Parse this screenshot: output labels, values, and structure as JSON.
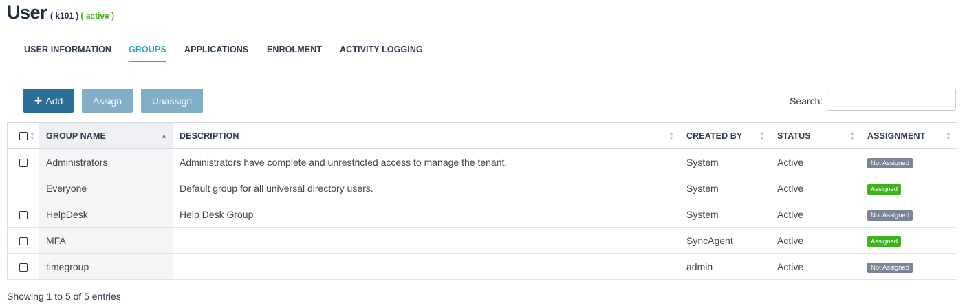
{
  "header": {
    "title": "User",
    "user_id": "( k101 )",
    "status": "( active )"
  },
  "tabs": [
    {
      "label": "USER INFORMATION",
      "active": false
    },
    {
      "label": "GROUPS",
      "active": true
    },
    {
      "label": "APPLICATIONS",
      "active": false
    },
    {
      "label": "ENROLMENT",
      "active": false
    },
    {
      "label": "ACTIVITY LOGGING",
      "active": false
    }
  ],
  "toolbar": {
    "add_label": "Add",
    "assign_label": "Assign",
    "unassign_label": "Unassign"
  },
  "search": {
    "label": "Search:",
    "value": "",
    "placeholder": ""
  },
  "table": {
    "columns": [
      "GROUP NAME",
      "DESCRIPTION",
      "CREATED BY",
      "STATUS",
      "ASSIGNMENT"
    ],
    "sort": {
      "column": "GROUP NAME",
      "direction": "ascending"
    },
    "rows": [
      {
        "checkbox": true,
        "name": "Administrators",
        "description": "Administrators have complete and unrestricted access to manage the tenant.",
        "created_by": "System",
        "status": "Active",
        "assignment": "Not Assigned"
      },
      {
        "checkbox": false,
        "name": "Everyone",
        "description": "Default group for all universal directory users.",
        "created_by": "System",
        "status": "Active",
        "assignment": "Assigned"
      },
      {
        "checkbox": true,
        "name": "HelpDesk",
        "description": "Help Desk Group",
        "created_by": "System",
        "status": "Active",
        "assignment": "Not Assigned"
      },
      {
        "checkbox": true,
        "name": "MFA",
        "description": "",
        "created_by": "SyncAgent",
        "status": "Active",
        "assignment": "Assigned"
      },
      {
        "checkbox": true,
        "name": "timegroup",
        "description": "",
        "created_by": "admin",
        "status": "Active",
        "assignment": "Not Assigned"
      }
    ]
  },
  "footer": {
    "info": "Showing 1 to 5 of 5 entries"
  },
  "colors": {
    "primary": "#2b6f97",
    "secondary": "#83aec7",
    "accent": "#29a8c4",
    "assigned": "#3fb21f",
    "not_assigned": "#7a8597",
    "active_status": "#4cae1f"
  }
}
